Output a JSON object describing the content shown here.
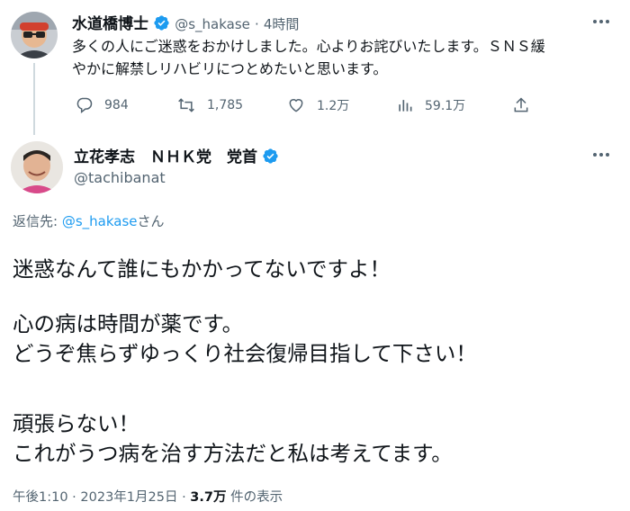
{
  "tweet1": {
    "name": "水道橋博士",
    "handle": "@s_hakase",
    "separator": "·",
    "time": "4時間",
    "line1": "多くの人にご迷惑をおかけしました。心よりお詫びいたします。ＳＮＳ緩",
    "line2": "やかに解禁しリハビリにつとめたいと思います。",
    "actions": {
      "reply_icon": "reply-icon",
      "reply_count": "984",
      "retweet_icon": "retweet-icon",
      "retweet_count": "1,785",
      "like_icon": "heart-icon",
      "like_count": "1.2万",
      "views_icon": "views-icon",
      "views_count": "59.1万",
      "share_icon": "share-icon"
    }
  },
  "tweet2": {
    "name": "立花孝志　ＮＨＫ党　党首",
    "handle": "@tachibanat",
    "reply_prefix": "返信先: ",
    "reply_handle": "@s_hakase",
    "reply_suffix": "さん",
    "paragraph1": "迷惑なんて誰にもかかってないですよ！",
    "paragraph2": "心の病は時間が薬です。\nどうぞ焦らずゆっくり社会復帰目指して下さい！",
    "paragraph3": "頑張らない！\nこれがうつ病を治す方法だと私は考えてます。",
    "meta_time": "午後1:10",
    "meta_sep": " · ",
    "meta_date": "2023年1月25日",
    "meta_views_count": "3.7万",
    "meta_views_label": " 件の表示"
  },
  "colors": {
    "verified_blue": "#1d9bf0",
    "gray_text": "#536471",
    "main_text": "#0f1419"
  }
}
